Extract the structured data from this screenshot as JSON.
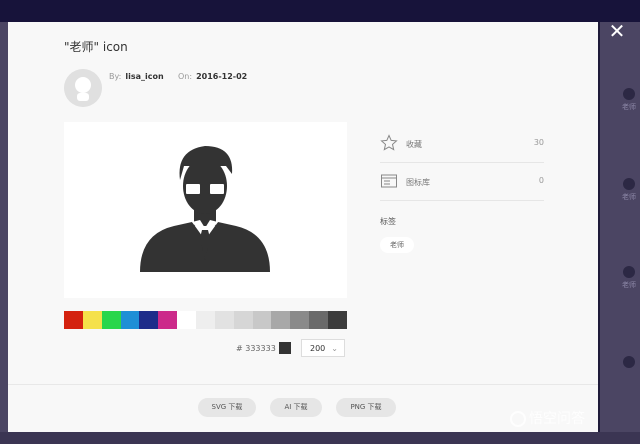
{
  "dialog": {
    "title": "\"老师\" icon",
    "author_label": "By:",
    "author": "lisa_icon",
    "date_label": "On:",
    "date": "2016-12-02"
  },
  "preview": {
    "icon": "teacher-with-glasses-icon",
    "swatch_colors": [
      "#d4220f",
      "#f5e14a",
      "#2ad64a",
      "#1f8fd6",
      "#1e2c8a",
      "#cc2a8a",
      "#ffffff",
      "#eeeeee",
      "#e2e2e2",
      "#d6d6d6",
      "#c8c8c8",
      "#a8a8a8",
      "#8a8a8a",
      "#6a6a6a",
      "#3c3c3c"
    ],
    "hex_prefix": "#",
    "hex_value": "333333",
    "size_value": "200"
  },
  "stats": {
    "favorite_label": "收藏",
    "favorite_count": "30",
    "library_label": "图标库",
    "library_count": "0",
    "tags_title": "标签",
    "tag": "老师"
  },
  "buttons": {
    "svg": "SVG 下载",
    "ai": "AI 下载",
    "png": "PNG 下载"
  },
  "background": {
    "thumb_label": "老师"
  },
  "watermark": "悟空问答"
}
